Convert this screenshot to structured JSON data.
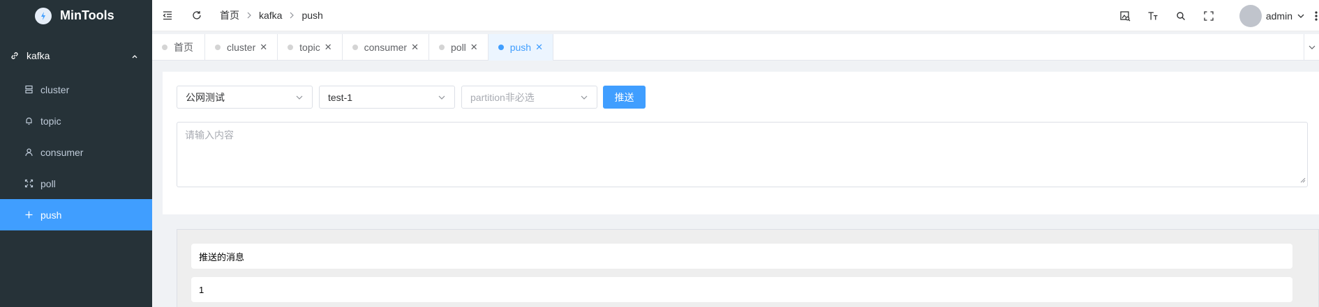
{
  "app": {
    "title": "MinTools"
  },
  "sidebar": {
    "group": {
      "label": "kafka",
      "icon": "link-icon"
    },
    "items": [
      {
        "label": "cluster",
        "icon": "server-icon"
      },
      {
        "label": "topic",
        "icon": "bell-icon"
      },
      {
        "label": "consumer",
        "icon": "user-icon"
      },
      {
        "label": "poll",
        "icon": "expand-icon"
      },
      {
        "label": "push",
        "icon": "plus-icon",
        "active": true
      }
    ]
  },
  "header": {
    "breadcrumb": [
      "首页",
      "kafka",
      "push"
    ],
    "user": "admin"
  },
  "tabs": [
    {
      "label": "首页",
      "closable": false
    },
    {
      "label": "cluster",
      "closable": true
    },
    {
      "label": "topic",
      "closable": true
    },
    {
      "label": "consumer",
      "closable": true
    },
    {
      "label": "poll",
      "closable": true
    },
    {
      "label": "push",
      "closable": true,
      "active": true
    }
  ],
  "form": {
    "cluster_select": "公网测试",
    "topic_select": "test-1",
    "partition_placeholder": "partition非必选",
    "push_button": "推送",
    "content_placeholder": "请输入内容"
  },
  "messages": {
    "header": "推送的消息",
    "rows": [
      "1"
    ]
  },
  "colors": {
    "sidebar_bg": "#263238",
    "accent": "#409eff",
    "active_tab_bg": "#ecf5ff"
  }
}
